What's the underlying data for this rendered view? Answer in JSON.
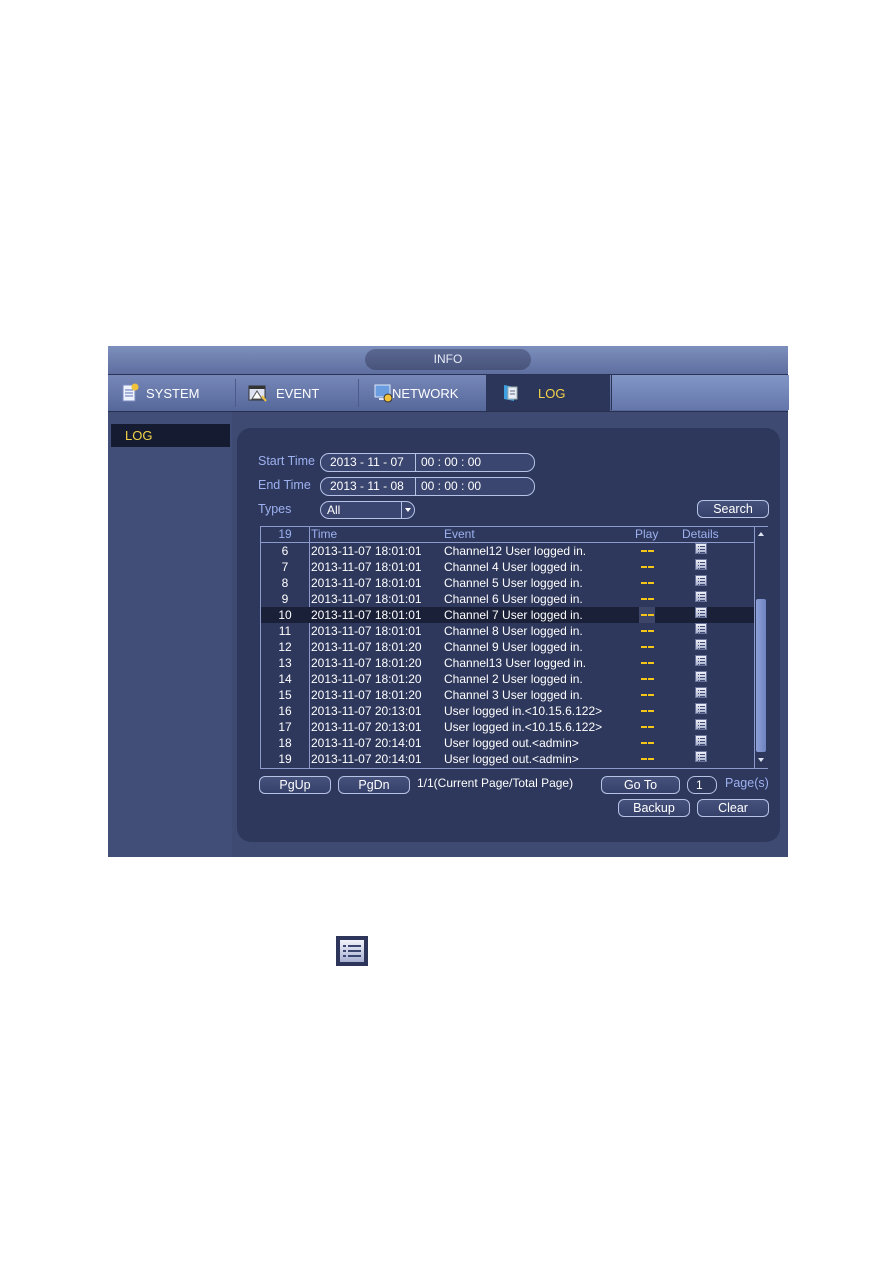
{
  "window": {
    "title": "INFO",
    "tabs": [
      {
        "label": "SYSTEM",
        "icon": "system-icon",
        "active": false
      },
      {
        "label": "EVENT",
        "icon": "event-icon",
        "active": false
      },
      {
        "label": "NETWORK",
        "icon": "network-icon",
        "active": false
      },
      {
        "label": "LOG",
        "icon": "log-icon",
        "active": true
      }
    ],
    "sidebar": {
      "items": [
        {
          "label": "LOG",
          "active": true
        }
      ]
    }
  },
  "filters": {
    "start_time_label": "Start Time",
    "start_date": "2013 - 11 - 07",
    "start_time": "00 : 00 : 00",
    "end_time_label": "End Time",
    "end_date": "2013 - 11 - 08",
    "end_time": "00 : 00 : 00",
    "types_label": "Types",
    "types_value": "All",
    "search_label": "Search"
  },
  "table": {
    "headers": {
      "count": "19",
      "time": "Time",
      "event": "Event",
      "play": "Play",
      "details": "Details"
    },
    "selected_row": "10",
    "rows": [
      {
        "no": "6",
        "time": "2013-11-07 18:01:01",
        "event": "Channel12  User logged in."
      },
      {
        "no": "7",
        "time": "2013-11-07 18:01:01",
        "event": "Channel 4  User logged in."
      },
      {
        "no": "8",
        "time": "2013-11-07 18:01:01",
        "event": "Channel 5  User logged in."
      },
      {
        "no": "9",
        "time": "2013-11-07 18:01:01",
        "event": "Channel 6  User logged in."
      },
      {
        "no": "10",
        "time": "2013-11-07 18:01:01",
        "event": "Channel 7  User logged in."
      },
      {
        "no": "11",
        "time": "2013-11-07 18:01:01",
        "event": "Channel 8  User logged in."
      },
      {
        "no": "12",
        "time": "2013-11-07 18:01:20",
        "event": "Channel 9  User logged in."
      },
      {
        "no": "13",
        "time": "2013-11-07 18:01:20",
        "event": "Channel13  User logged in."
      },
      {
        "no": "14",
        "time": "2013-11-07 18:01:20",
        "event": "Channel 2  User logged in."
      },
      {
        "no": "15",
        "time": "2013-11-07 18:01:20",
        "event": "Channel 3  User logged in."
      },
      {
        "no": "16",
        "time": "2013-11-07 20:13:01",
        "event": "User logged in.<10.15.6.122>"
      },
      {
        "no": "17",
        "time": "2013-11-07 20:13:01",
        "event": "User logged in.<10.15.6.122>"
      },
      {
        "no": "18",
        "time": "2013-11-07 20:14:01",
        "event": "User logged out.<admin>"
      },
      {
        "no": "19",
        "time": "2013-11-07 20:14:01",
        "event": "User logged out.<admin>"
      }
    ],
    "play_value": "--",
    "details_icon": "details-list-icon"
  },
  "pagination": {
    "pgup_label": "PgUp",
    "pgdn_label": "PgDn",
    "page_info": "1/1(Current Page/Total Page)",
    "goto_label": "Go To",
    "goto_value": "1",
    "pages_label": "Page(s)"
  },
  "actions": {
    "backup_label": "Backup",
    "clear_label": "Clear"
  },
  "colors": {
    "accent_active": "#f3d44a",
    "label_blue": "#9db1f0",
    "play_dash": "#f3c619",
    "panel_bg": "#2e385c",
    "window_bg": "#3e4a72"
  }
}
